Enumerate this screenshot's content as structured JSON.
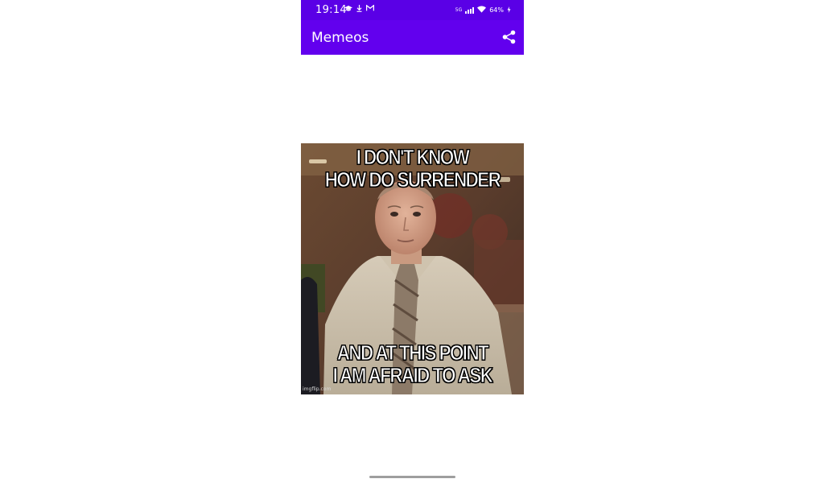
{
  "status_bar": {
    "time": "19:14",
    "left_icons": [
      "graduation-cap-icon",
      "download-icon",
      "gmail-icon"
    ],
    "network_label": "5G",
    "battery_text": "64%"
  },
  "app_bar": {
    "title": "Memeos",
    "action_icon": "share-icon",
    "background_color": "#6200ee",
    "status_color": "#5a00e6"
  },
  "meme": {
    "top_text": [
      "I DON'T KNOW",
      "HOW DO SURRENDER"
    ],
    "bottom_text": [
      "AND AT THIS POINT",
      "I AM AFRAID TO ASK"
    ],
    "watermark": "imgflip.com"
  }
}
